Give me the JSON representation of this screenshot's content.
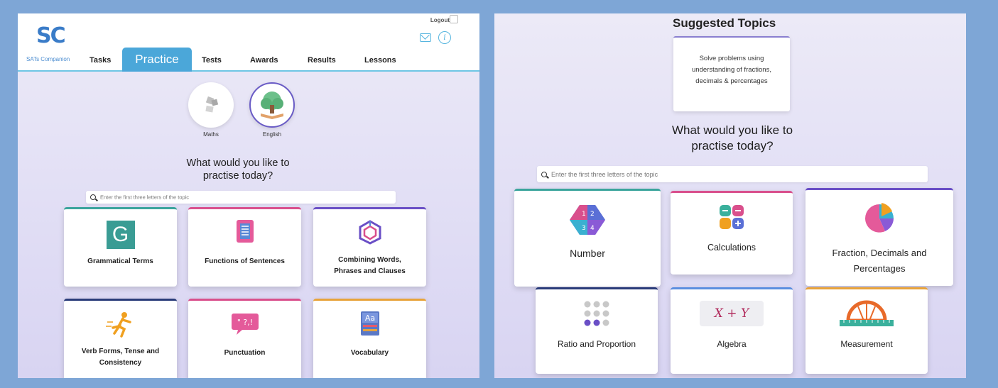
{
  "left_screen": {
    "logo": "SC",
    "logo_sub": "SATs Companion",
    "logout": "Logout",
    "nav": [
      "Tasks",
      "Practice",
      "Tests",
      "Awards",
      "Results",
      "Lessons"
    ],
    "subjects": [
      "Maths",
      "English"
    ],
    "question_line1": "What would you like to",
    "question_line2": "practise today?",
    "search_placeholder": "Enter the first three letters of the topic",
    "cards": [
      {
        "label_l1": "Grammatical Terms",
        "label_l2": "",
        "accent": "#3aa49c"
      },
      {
        "label_l1": "Functions of Sentences",
        "label_l2": "",
        "accent": "#d94f8c"
      },
      {
        "label_l1": "Combining Words,",
        "label_l2": "Phrases and Clauses",
        "accent": "#6a4fc6"
      },
      {
        "label_l1": "Verb Forms, Tense and",
        "label_l2": "Consistency",
        "accent": "#2a3c7a"
      },
      {
        "label_l1": "Punctuation",
        "label_l2": "",
        "accent": "#d94f8c"
      },
      {
        "label_l1": "Vocabulary",
        "label_l2": "",
        "accent": "#e8a33a"
      }
    ]
  },
  "right_screen": {
    "suggested_title": "Suggested Topics",
    "suggested_text": "Solve problems using understanding of fractions, decimals & percentages",
    "question_line1": "What would you like to",
    "question_line2": "practise today?",
    "search_placeholder": "Enter the first three letters of the topic",
    "cards": [
      {
        "label_l1": "Number",
        "label_l2": "",
        "accent": "#3aa49c"
      },
      {
        "label_l1": "Calculations",
        "label_l2": "",
        "accent": "#d94f8c"
      },
      {
        "label_l1": "Fraction, Decimals and",
        "label_l2": "Percentages",
        "accent": "#6a4fc6"
      },
      {
        "label_l1": "Ratio and Proportion",
        "label_l2": "",
        "accent": "#2a3c7a"
      },
      {
        "label_l1": "Algebra",
        "label_l2": "",
        "accent": "#5b8ee0"
      },
      {
        "label_l1": "Measurement",
        "label_l2": "",
        "accent": "#e8a33a"
      }
    ],
    "algebra_glyph": "X + Y"
  }
}
